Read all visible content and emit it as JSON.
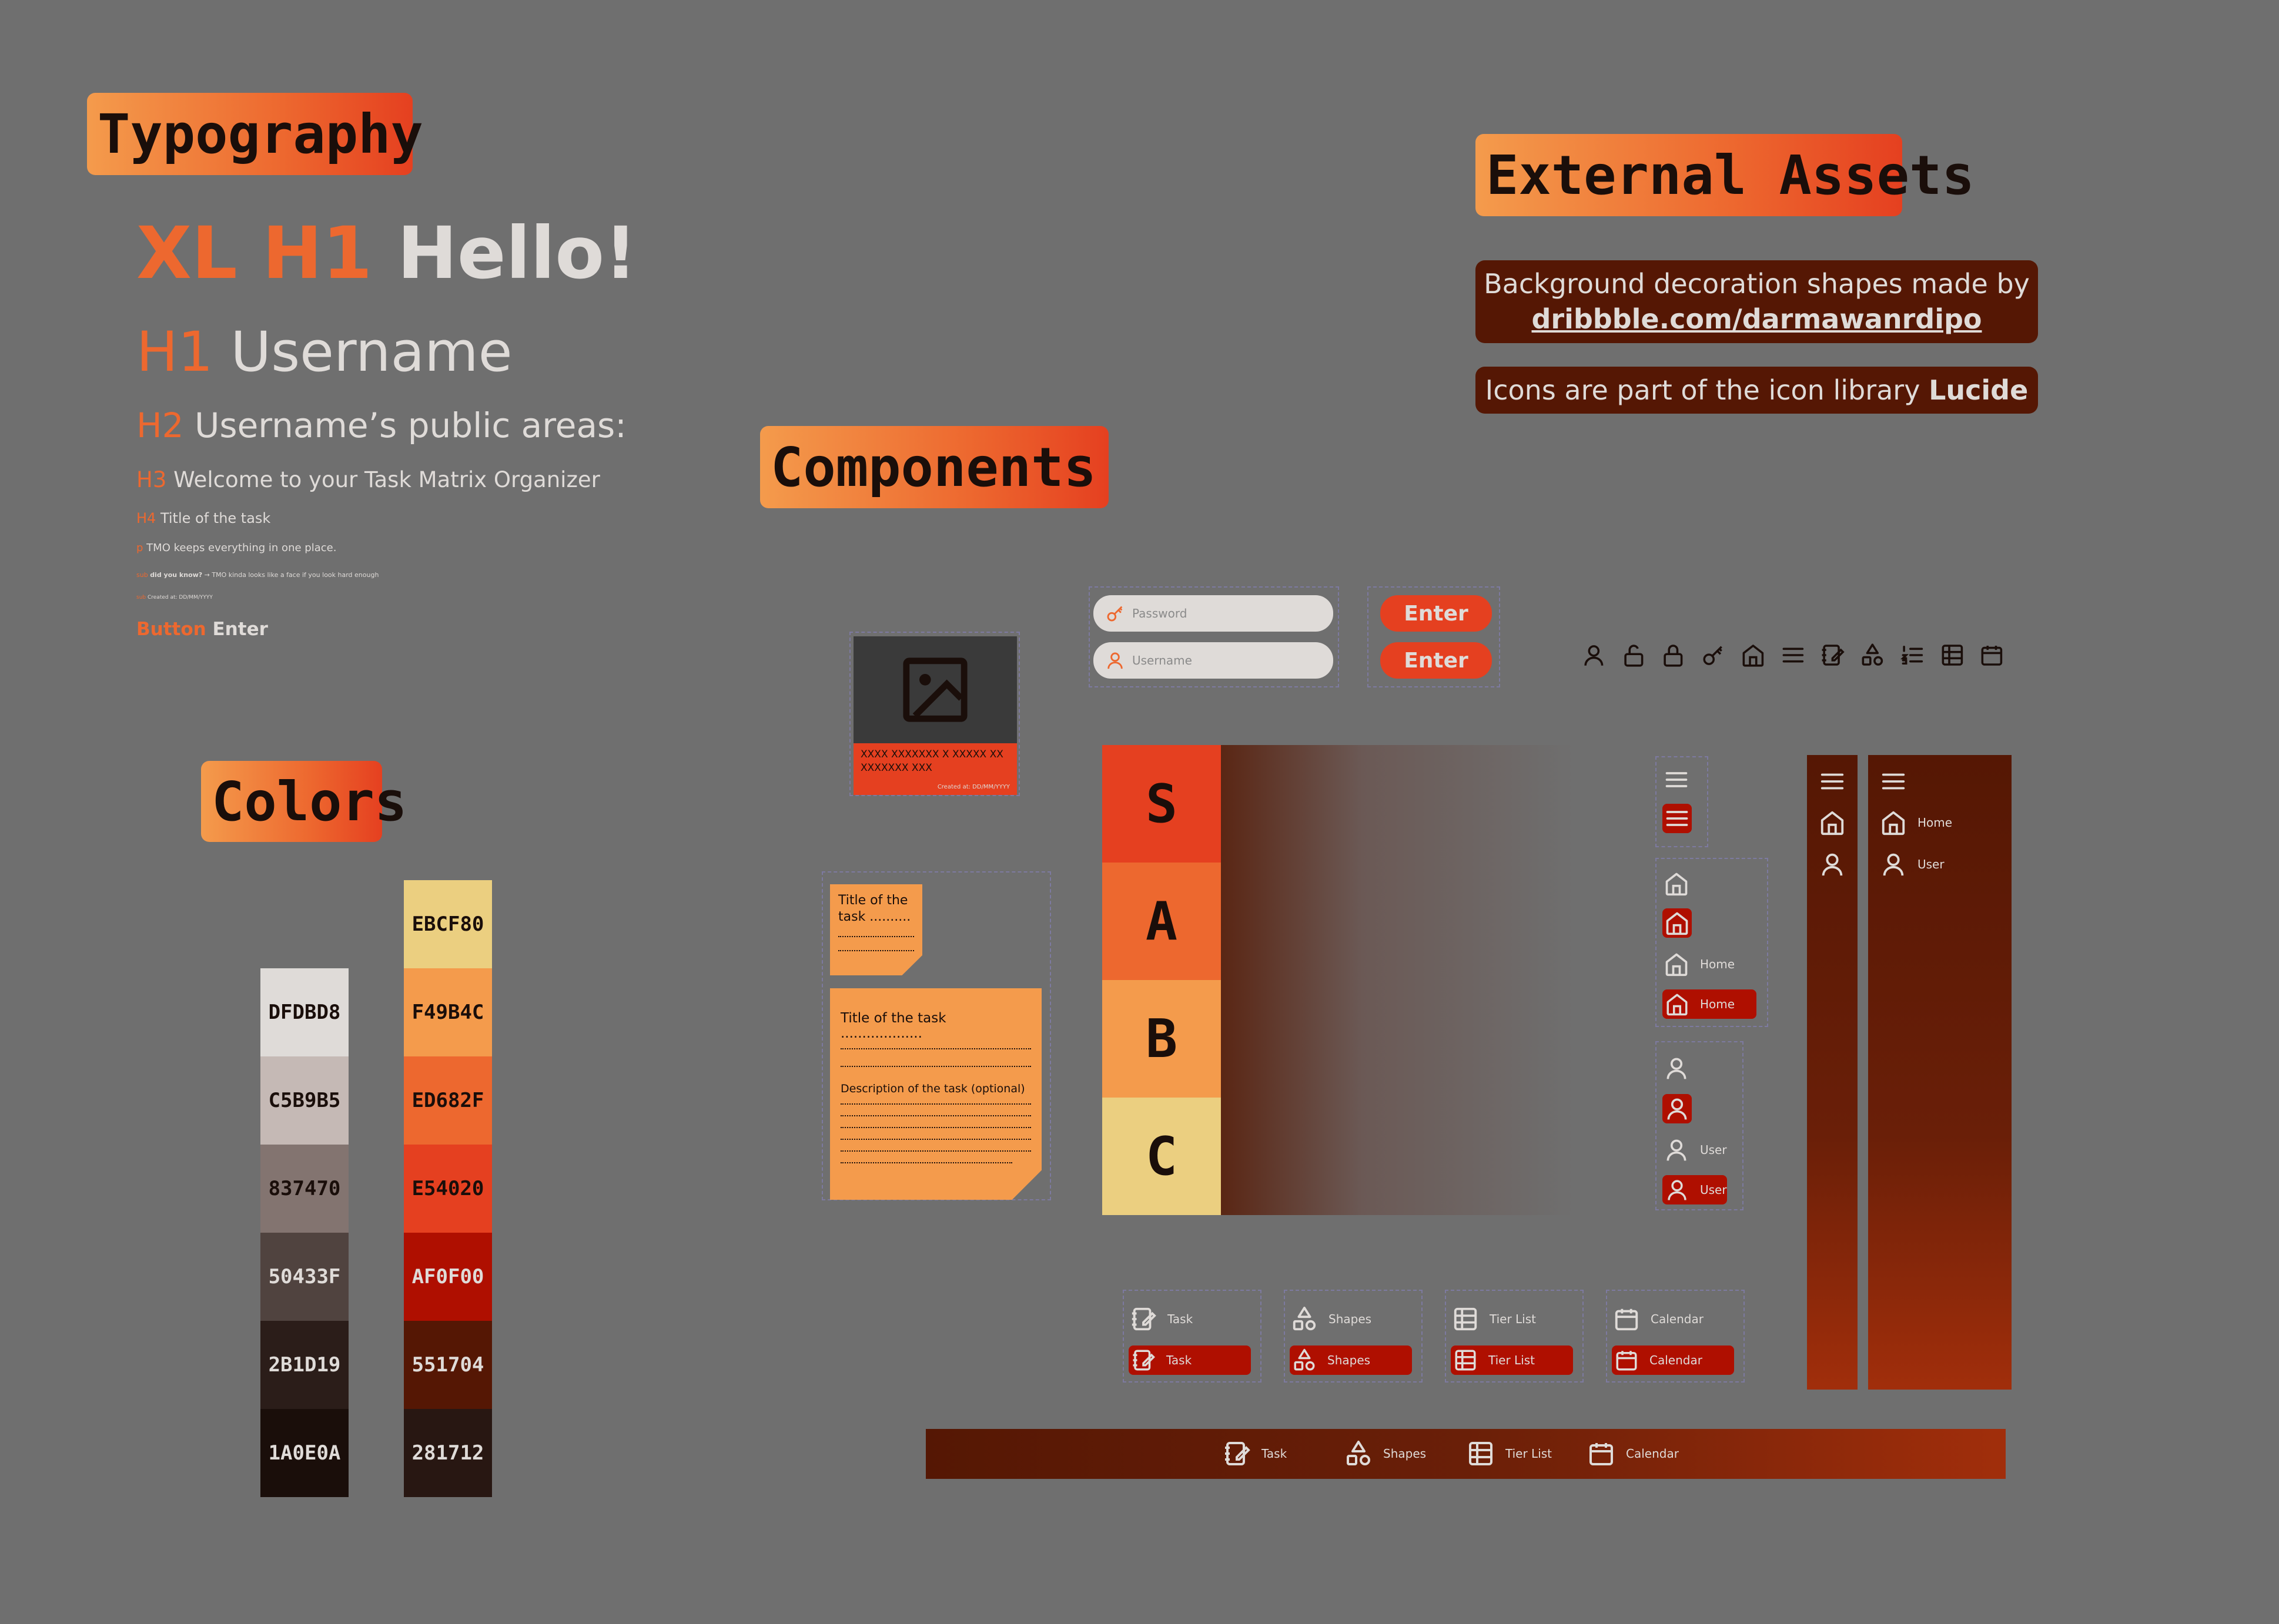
{
  "sections": {
    "typography": "Typography",
    "colors": "Colors",
    "components": "Components",
    "external_assets": "External Assets"
  },
  "typography": {
    "xl_h1_tag": "XL H1",
    "xl_h1_text": "Hello!",
    "h1_tag": "H1",
    "h1_text": "Username",
    "h2_tag": "H2",
    "h2_text": "Username’s public areas:",
    "h3_tag": "H3",
    "h3_text": "Welcome to your Task Matrix Organizer",
    "h4_tag": "H4",
    "h4_text": "Title of the task",
    "p_tag": "p",
    "p_text": "TMO keeps everything in one place.",
    "sub_tag": "sub",
    "sub_bold": "did you know?",
    "sub_text": "→ TMO kinda looks like a face if you look hard enough",
    "sub2_tag": "sub",
    "sub2_text": "Created at: DD/MM/YYYY",
    "button_tag": "Button",
    "button_text": "Enter"
  },
  "colors": {
    "neutrals": [
      {
        "hex": "DFDBD8",
        "color": "#DFDBD8",
        "text": "#1a0e0a"
      },
      {
        "hex": "C5B9B5",
        "color": "#C5B9B5",
        "text": "#1a0e0a"
      },
      {
        "hex": "837470",
        "color": "#837470",
        "text": "#1a0e0a"
      },
      {
        "hex": "50433F",
        "color": "#50433F",
        "text": "#dfdbd8"
      },
      {
        "hex": "2B1D19",
        "color": "#2B1D19",
        "text": "#dfdbd8"
      },
      {
        "hex": "1A0E0A",
        "color": "#1A0E0A",
        "text": "#dfdbd8"
      }
    ],
    "warm": [
      {
        "hex": "EBCF80",
        "color": "#EBCF80",
        "text": "#1a0e0a"
      },
      {
        "hex": "F49B4C",
        "color": "#F49B4C",
        "text": "#1a0e0a"
      },
      {
        "hex": "ED682F",
        "color": "#ED682F",
        "text": "#1a0e0a"
      },
      {
        "hex": "E54020",
        "color": "#E54020",
        "text": "#1a0e0a"
      },
      {
        "hex": "AF0F00",
        "color": "#AF0F00",
        "text": "#dfdbd8"
      },
      {
        "hex": "551704",
        "color": "#551704",
        "text": "#dfdbd8"
      },
      {
        "hex": "281712",
        "color": "#281712",
        "text": "#dfdbd8"
      }
    ]
  },
  "external": {
    "line1": "Background decoration shapes made by",
    "link": "dribbble.com/darmawanrdipo",
    "line2_prefix": "Icons are part of the icon library",
    "line2_bold": "Lucide"
  },
  "components": {
    "card_caption": "XXXX XXXXXXX X XXXXX XX XXXXXXX XXX",
    "card_created": "Created at: DD/MM/YYYY",
    "password_placeholder": "Password",
    "username_placeholder": "Username",
    "enter_label": "Enter",
    "sticky_small_title": "Title of the task ..........",
    "sticky_large_title": "Title of the task ...................",
    "sticky_desc": "Description of the task (optional)",
    "tiers": [
      "S",
      "A",
      "B",
      "C"
    ],
    "nav_home": "Home",
    "nav_user": "User",
    "tabs": [
      "Task",
      "Shapes",
      "Tier List",
      "Calendar"
    ],
    "icon_row": [
      "user-icon",
      "unlock-icon",
      "lock-icon",
      "key-icon",
      "home-icon",
      "menu-icon",
      "notebook-pen-icon",
      "shapes-icon",
      "list-ordered-icon",
      "table-icon",
      "calendar-icon"
    ]
  },
  "accent": {
    "orange": "#ED682F",
    "red": "#E54020",
    "dark_red": "#AF0F00",
    "brown": "#551704"
  }
}
